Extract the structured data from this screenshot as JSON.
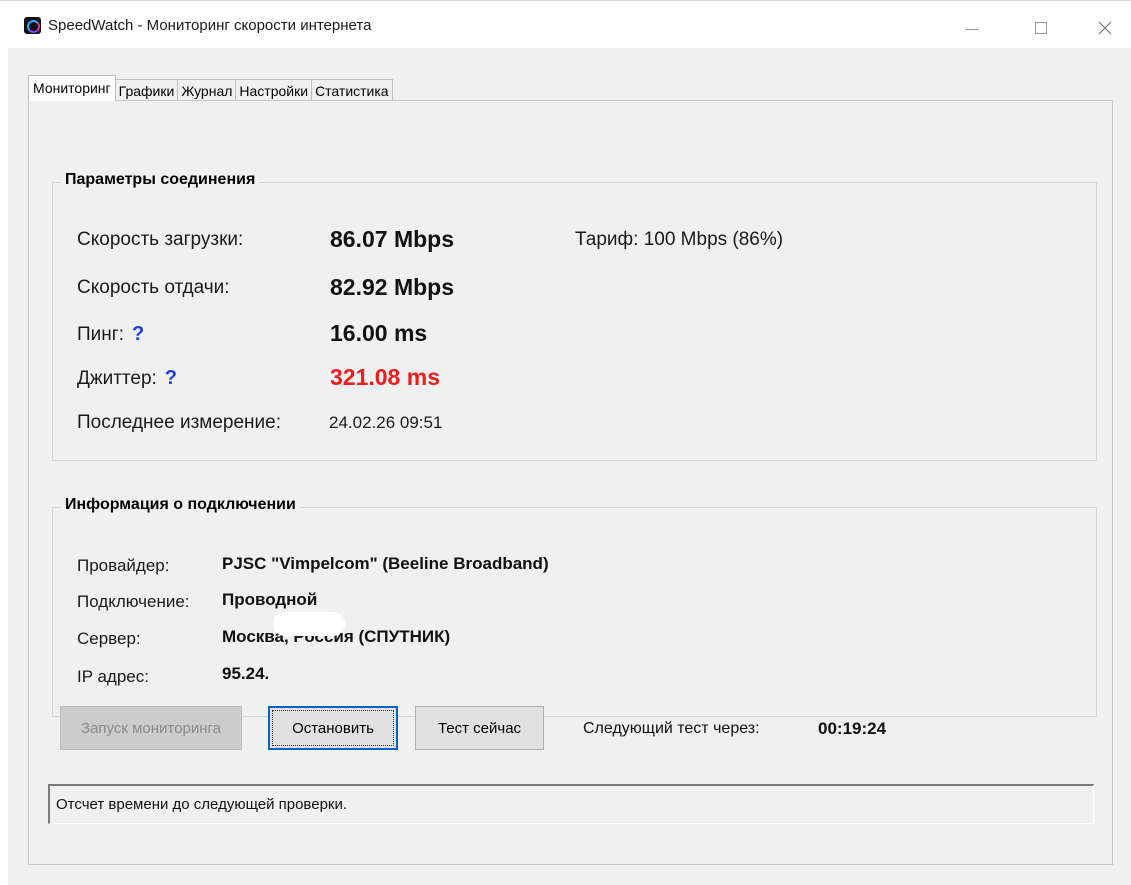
{
  "window": {
    "title": "SpeedWatch - Мониторинг скорости интернета",
    "icon": "speedwatch-app-icon"
  },
  "tabs": [
    {
      "label": "Мониторинг",
      "active": true
    },
    {
      "label": "Графики",
      "active": false
    },
    {
      "label": "Журнал",
      "active": false
    },
    {
      "label": "Настройки",
      "active": false
    },
    {
      "label": "Статистика",
      "active": false
    }
  ],
  "connection_params": {
    "title": "Параметры соединения",
    "download_label": "Скорость загрузки:",
    "download_value": "86.07 Mbps",
    "tariff": "Тариф: 100 Mbps (86%)",
    "upload_label": "Скорость отдачи:",
    "upload_value": "82.92 Mbps",
    "ping_label": "Пинг:",
    "ping_value": "16.00 ms",
    "jitter_label": "Джиттер:",
    "jitter_value": "321.08 ms",
    "help_glyph": "?",
    "last_label": "Последнее измерение:",
    "last_value": "24.02.26 09:51"
  },
  "connection_info": {
    "title": "Информация о подключении",
    "provider_label": "Провайдер:",
    "provider_value": "PJSC \"Vimpelcom\" (Beeline Broadband)",
    "connection_label": "Подключение:",
    "connection_value": "Проводной",
    "server_label": "Сервер:",
    "server_value": "Москва, Россия (СПУТНИК)",
    "ip_label": "IP адрес:",
    "ip_value": "95.24."
  },
  "controls": {
    "start_label": "Запуск мониторинга",
    "stop_label": "Остановить",
    "test_label": "Тест сейчас",
    "next_label": "Следующий тест через:",
    "next_value": "00:19:24"
  },
  "status": {
    "text": "Отсчет времени до следующей проверки."
  },
  "colors": {
    "jitter_alert": "#ee1c1c",
    "help_icon": "#1d3fe0",
    "focus_border": "#0a62c7"
  }
}
